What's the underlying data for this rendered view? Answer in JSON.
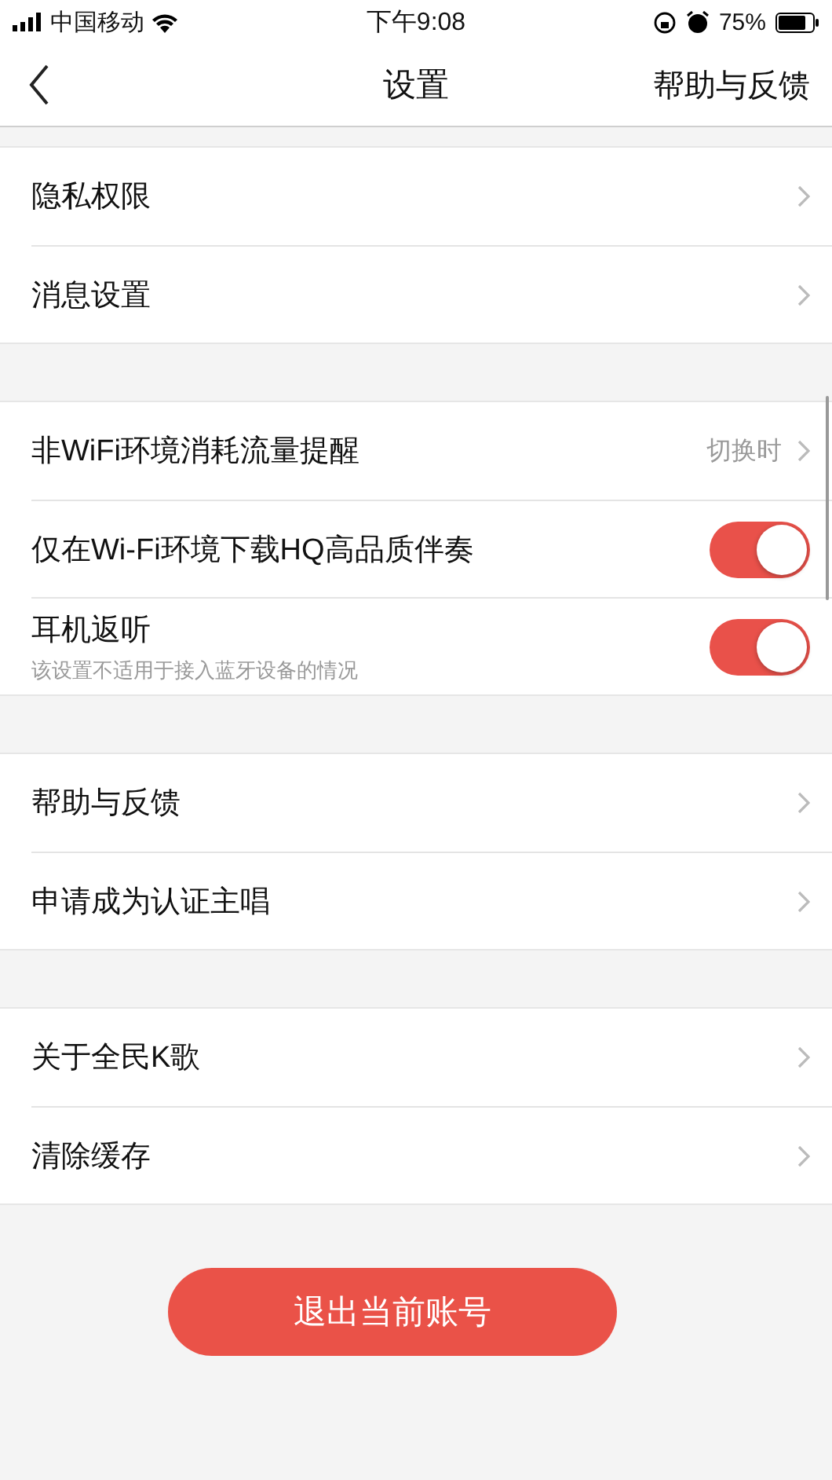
{
  "status_bar": {
    "carrier": "中国移动",
    "time": "下午9:08",
    "battery": "75%"
  },
  "nav": {
    "title": "设置",
    "action": "帮助与反馈"
  },
  "groups": [
    {
      "items": [
        {
          "kind": "link",
          "label": "隐私权限"
        },
        {
          "kind": "link",
          "label": "消息设置"
        }
      ]
    },
    {
      "items": [
        {
          "kind": "link",
          "label": "非WiFi环境消耗流量提醒",
          "value": "切换时"
        },
        {
          "kind": "toggle",
          "label": "仅在Wi-Fi环境下载HQ高品质伴奏",
          "on": true
        },
        {
          "kind": "toggle",
          "label": "耳机返听",
          "subtitle": "该设置不适用于接入蓝牙设备的情况",
          "on": true
        }
      ]
    },
    {
      "items": [
        {
          "kind": "link",
          "label": "帮助与反馈"
        },
        {
          "kind": "link",
          "label": "申请成为认证主唱"
        }
      ]
    },
    {
      "items": [
        {
          "kind": "link",
          "label": "关于全民K歌"
        },
        {
          "kind": "link",
          "label": "清除缓存"
        }
      ]
    }
  ],
  "logout": {
    "label": "退出当前账号"
  }
}
